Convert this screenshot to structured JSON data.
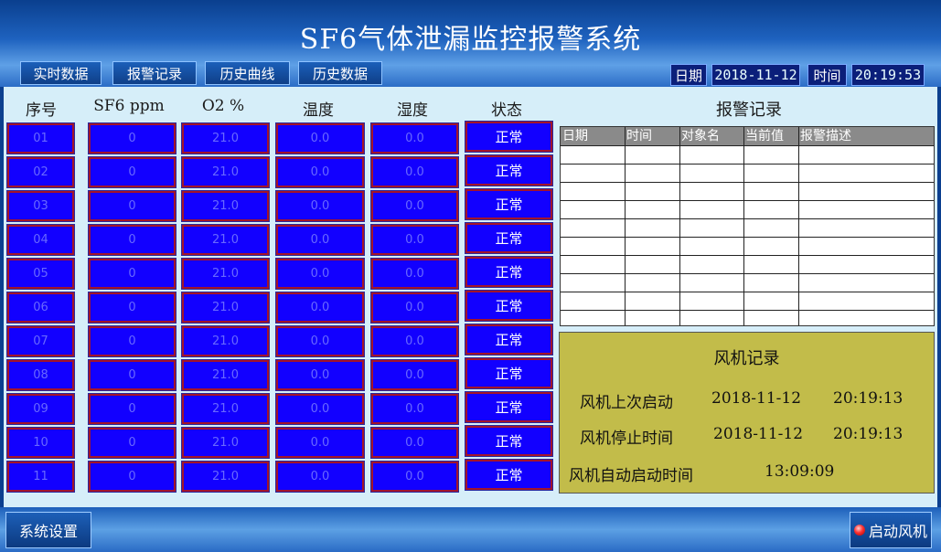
{
  "header": {
    "title": "SF6气体泄漏监控报警系统",
    "tabs": [
      {
        "label": "实时数据"
      },
      {
        "label": "报警记录"
      },
      {
        "label": "历史曲线"
      },
      {
        "label": "历史数据"
      }
    ],
    "date_label": "日期",
    "date_value": "2018-11-12",
    "time_label": "时间",
    "time_value": "20:19:53"
  },
  "table": {
    "columns": [
      "序号",
      "SF6 ppm",
      "O2 %",
      "温度",
      "湿度",
      "状态"
    ],
    "rows": [
      {
        "id": "01",
        "sf6": "0",
        "o2": "21.0",
        "temp": "0.0",
        "hum": "0.0",
        "status": "正常"
      },
      {
        "id": "02",
        "sf6": "0",
        "o2": "21.0",
        "temp": "0.0",
        "hum": "0.0",
        "status": "正常"
      },
      {
        "id": "03",
        "sf6": "0",
        "o2": "21.0",
        "temp": "0.0",
        "hum": "0.0",
        "status": "正常"
      },
      {
        "id": "04",
        "sf6": "0",
        "o2": "21.0",
        "temp": "0.0",
        "hum": "0.0",
        "status": "正常"
      },
      {
        "id": "05",
        "sf6": "0",
        "o2": "21.0",
        "temp": "0.0",
        "hum": "0.0",
        "status": "正常"
      },
      {
        "id": "06",
        "sf6": "0",
        "o2": "21.0",
        "temp": "0.0",
        "hum": "0.0",
        "status": "正常"
      },
      {
        "id": "07",
        "sf6": "0",
        "o2": "21.0",
        "temp": "0.0",
        "hum": "0.0",
        "status": "正常"
      },
      {
        "id": "08",
        "sf6": "0",
        "o2": "21.0",
        "temp": "0.0",
        "hum": "0.0",
        "status": "正常"
      },
      {
        "id": "09",
        "sf6": "0",
        "o2": "21.0",
        "temp": "0.0",
        "hum": "0.0",
        "status": "正常"
      },
      {
        "id": "10",
        "sf6": "0",
        "o2": "21.0",
        "temp": "0.0",
        "hum": "0.0",
        "status": "正常"
      },
      {
        "id": "11",
        "sf6": "0",
        "o2": "21.0",
        "temp": "0.0",
        "hum": "0.0",
        "status": "正常"
      }
    ]
  },
  "alarm": {
    "title": "报警记录",
    "columns": [
      "日期",
      "时间",
      "对象名",
      "当前值",
      "报警描述"
    ]
  },
  "fan": {
    "title": "风机记录",
    "last_start_label": "风机上次启动",
    "last_start_date": "2018-11-12",
    "last_start_time": "20:19:13",
    "stop_label": "风机停止时间",
    "stop_date": "2018-11-12",
    "stop_time": "20:19:13",
    "auto_label": "风机自动启动时间",
    "auto_time": "13:09:09"
  },
  "footer": {
    "settings_label": "系统设置",
    "start_fan_label": "启动风机"
  },
  "colors": {
    "cell_fill": "#1200ff",
    "cell_border": "#a3142a",
    "fan_panel": "#c2bc4a",
    "status_led": "#ff3030"
  }
}
